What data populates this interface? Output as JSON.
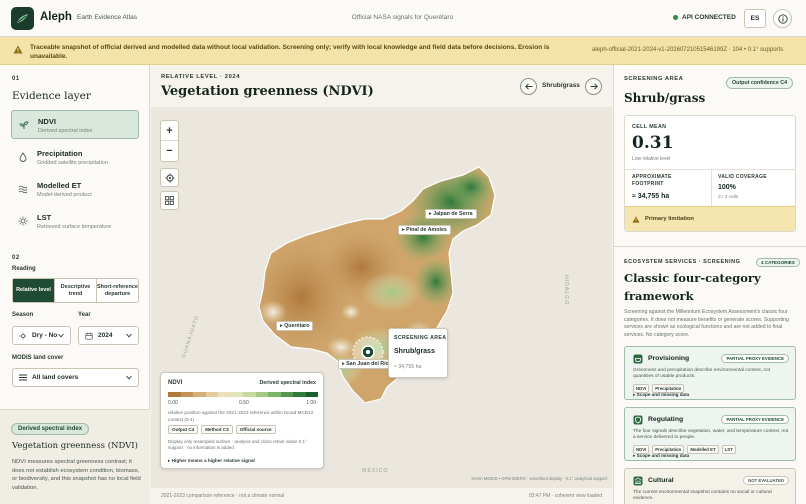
{
  "app": {
    "name": "Aleph",
    "subtitle": "Earth Evidence Atlas",
    "center_text": "Official NASA signals for Querétaro",
    "api_status": "API CONNECTED",
    "language": "ES"
  },
  "banner": {
    "text": "Traceable snapshot of official derived and modelled data without local validation. Screening only; verify with local knowledge and field data before decisions. Erosion is unavailable.",
    "snapshot_id": "aleph-official-2021-2024-v1-20260721051546199Z · 104 • 0.1° supports"
  },
  "left": {
    "section1_num": "01",
    "section1_title": "Evidence layer",
    "layers": [
      {
        "name": "NDVI",
        "desc": "Derived spectral index",
        "icon": "sprout-icon"
      },
      {
        "name": "Precipitation",
        "desc": "Gridded satellite precipitation",
        "icon": "droplet-icon"
      },
      {
        "name": "Modelled ET",
        "desc": "Model-derived product",
        "icon": "waves-icon"
      },
      {
        "name": "LST",
        "desc": "Retrieved surface temperature",
        "icon": "sun-icon"
      }
    ],
    "section2_num": "02",
    "reading_label": "Reading",
    "reading_options": [
      "Relative level",
      "Descriptive trend",
      "Short-reference departure"
    ],
    "reading_selected": "Relative level",
    "season_label": "Season",
    "season_value": "Dry - No",
    "year_label": "Year",
    "year_value": "2024",
    "modis_label": "MODIS land cover",
    "modis_value": "All land covers",
    "bottom_badge": "Derived spectral index",
    "bottom_title": "Vegetation greenness (NDVI)",
    "bottom_desc": "NDVI measures spectral greenness contrast; it does not establish ecosystem condition, biomass, or biodiversity, and this snapshot has no local field validation."
  },
  "center": {
    "kicker": "RELATIVE LEVEL · 2024",
    "title": "Vegetation greenness (NDVI)",
    "nav_label": "Shrub/grass",
    "cities": [
      "Jalpan de Serra",
      "Pinal de Amoles",
      "Querétaro",
      "San Juan del Río"
    ],
    "geo_labels": [
      "GUANAJUATO",
      "HIDALGO",
      "MÉXICO"
    ],
    "popup": {
      "label": "SCREENING AREA",
      "name": "Shrub/grass",
      "area": "≈ 34,755 ha"
    },
    "legend": {
      "name": "NDVI",
      "type": "Derived spectral index",
      "ticks": [
        "0.00",
        "0.50",
        "1.00"
      ],
      "desc": "relative position against the 2021-2023 reference within broad MCD12 context (0-1)",
      "tags": [
        "Output C4",
        "Method C3",
        "Official source"
      ],
      "note": "Display only resampled surface · analysis and clicks retain native 0.1° support · no information is added",
      "more": "▸ Higher means a higher relative signal",
      "colors": [
        "#b07a3a",
        "#c4935a",
        "#d5ae78",
        "#e3cb9c",
        "#ebe0bc",
        "#dfe4b8",
        "#c7d99e",
        "#a4c983",
        "#7cb468",
        "#52964f",
        "#2f7a3d",
        "#1d5e2e"
      ]
    },
    "attribution": "NASA MODIS • GPM IMERG · smoothed display · 0.1° analytical support",
    "footer_left": "2021-2023 comparison reference · not a climate normal",
    "footer_right": "03:47 PM · coherent view loaded"
  },
  "right": {
    "label": "SCREENING AREA",
    "confidence": "Output confidence C4",
    "title": "Shrub/grass",
    "cell_mean_label": "CELL MEAN",
    "cell_mean_value": "0.31",
    "cell_mean_sub": "Low relative level",
    "footprint_label": "APPROXIMATE FOOTPRINT",
    "footprint_value": "≈ 34,755 ha",
    "coverage_label": "VALID COVERAGE",
    "coverage_value": "100%",
    "coverage_sub": "3 / 3 cells",
    "limitation": "Primary limitation",
    "es_label": "ECOSYSTEM SERVICES · SCREENING",
    "es_count": "4 CATEGORIES",
    "es_title": "Classic four-category framework",
    "es_desc": "Screening against the Millennium Ecosystem Assessment's classic four categories. It does not measure benefits or generate scores. Supporting services are shown as ecological functions and are not added to final services. No category score.",
    "services": [
      {
        "name": "Provisioning",
        "badge": "PARTIAL PROXY EVIDENCE",
        "desc": "Greenness and precipitation describe environmental context, not quantities of usable products.",
        "tags": [
          "NDVI",
          "Precipitation"
        ],
        "more": "▸ Scope and missing data"
      },
      {
        "name": "Regulating",
        "badge": "PARTIAL PROXY EVIDENCE",
        "desc": "The four signals describe vegetation, water, and temperature context, not a service delivered to people.",
        "tags": [
          "NDVI",
          "Precipitation",
          "Modelled ET",
          "LST"
        ],
        "more": "▸ Scope and missing data"
      },
      {
        "name": "Cultural",
        "badge": "NOT EVALUATED",
        "desc": "The current environmental snapshot contains no social or cultural evidence."
      }
    ]
  }
}
